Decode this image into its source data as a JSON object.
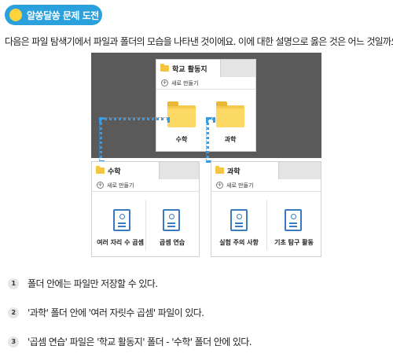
{
  "badge": {
    "text": "알쏭달쏭 문제 도전",
    "icon": "lightbulb-icon",
    "color": "#2aa0dd"
  },
  "question": "다음은 파일 탐색기에서 파일과 폴더의 모습을 나타낸 것이에요. 이에 대한 설명으로 옳은 것은 어느 것일까요?",
  "explorer": {
    "new_label": "새로 만들기",
    "root": {
      "tab": "학교 활동지",
      "folders": [
        "수학",
        "과학"
      ]
    },
    "math": {
      "tab": "수학",
      "files": [
        "여러 자리 수 곱셈",
        "곱셈 연습"
      ]
    },
    "science": {
      "tab": "과학",
      "files": [
        "실험 주의 사항",
        "기초 탐구 활동"
      ]
    }
  },
  "options": [
    {
      "num": "1",
      "text": "폴더 안에는 파일만 저장할 수 있다."
    },
    {
      "num": "2",
      "text": "'과학' 폴더 안에 '여러 자릿수 곱셈' 파일이 있다."
    },
    {
      "num": "3",
      "text": "'곱셈 연습' 파일은 '학교 활동지' 폴더 - '수학' 폴더 안에 있다."
    }
  ]
}
